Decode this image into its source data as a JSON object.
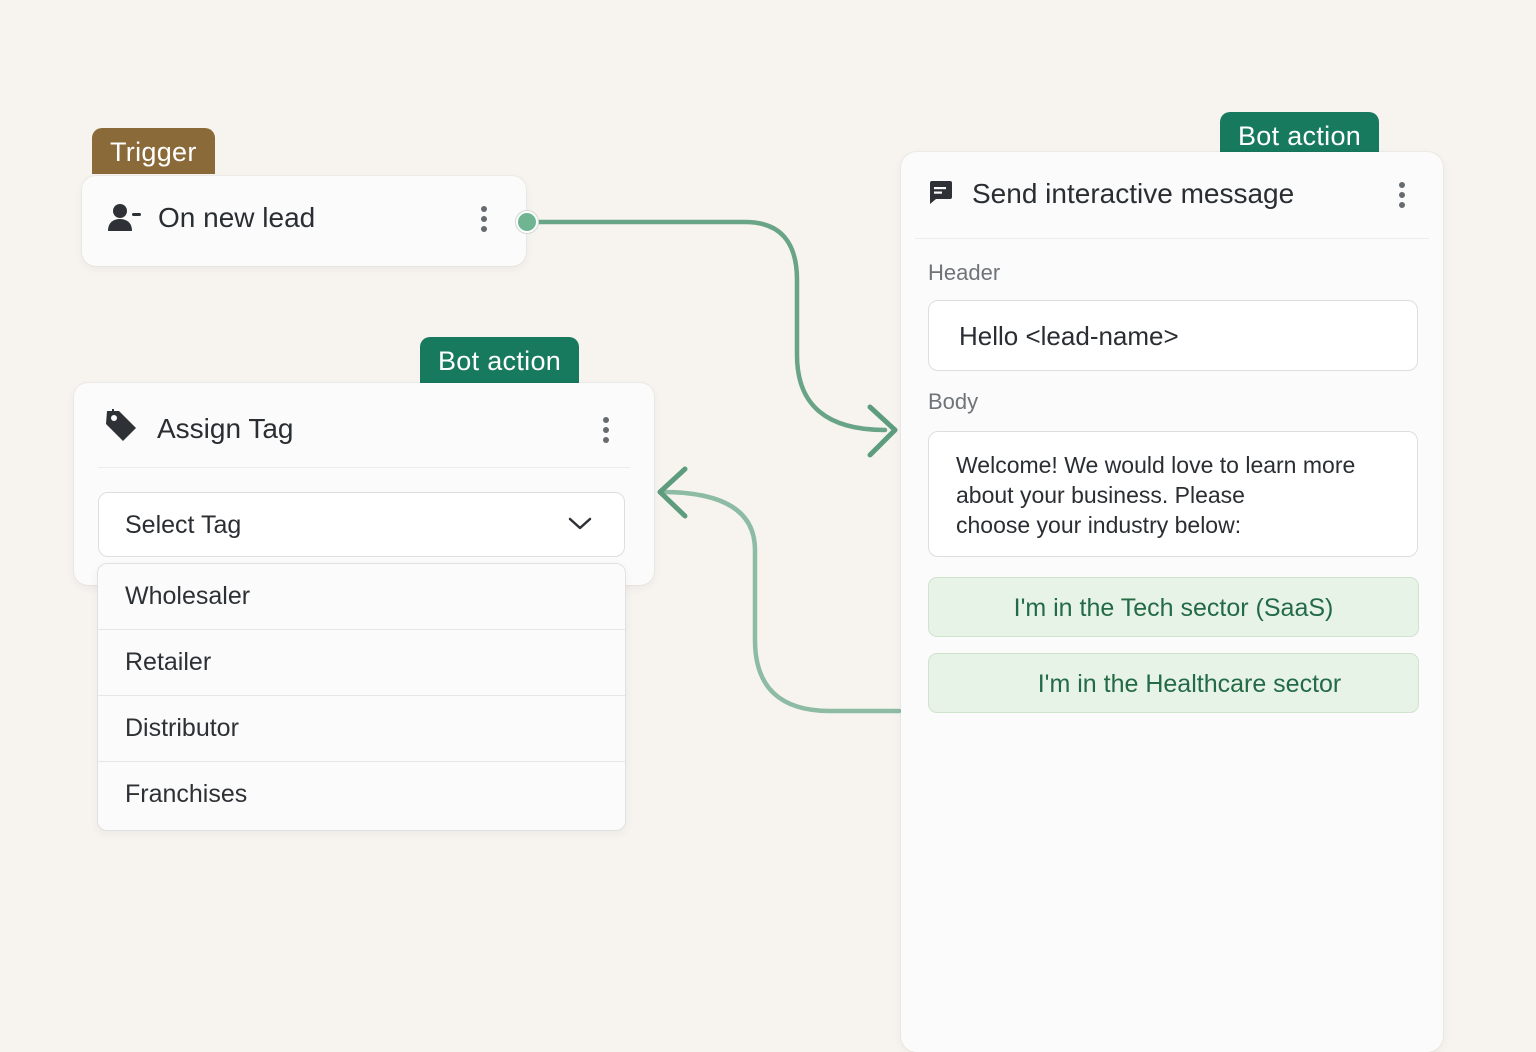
{
  "trigger_node": {
    "badge": "Trigger",
    "title": "On new lead",
    "icon": "user-plus-icon"
  },
  "assign_tag_node": {
    "badge": "Bot action",
    "title": "Assign Tag",
    "icon": "tag-icon",
    "select_value": "Select Tag",
    "options": [
      "Wholesaler",
      "Retailer",
      "Distributor",
      "Franchises"
    ]
  },
  "message_node": {
    "badge": "Bot action",
    "title": "Send interactive message",
    "icon": "message-icon",
    "header_label": "Header",
    "header_value": "Hello <lead-name>",
    "body_label": "Body",
    "body_lines": [
      "Welcome! We would love to learn more",
      "about your business. Please",
      "choose your industry below:"
    ],
    "buttons": [
      "I'm in the Tech sector (SaaS)",
      "I'm in the Healthcare sector"
    ]
  },
  "colors": {
    "connector": "#5e9c7e",
    "trigger_badge": "#8b6a39",
    "bot_badge": "#177a5e",
    "reply_button_bg": "#e8f3e7"
  }
}
